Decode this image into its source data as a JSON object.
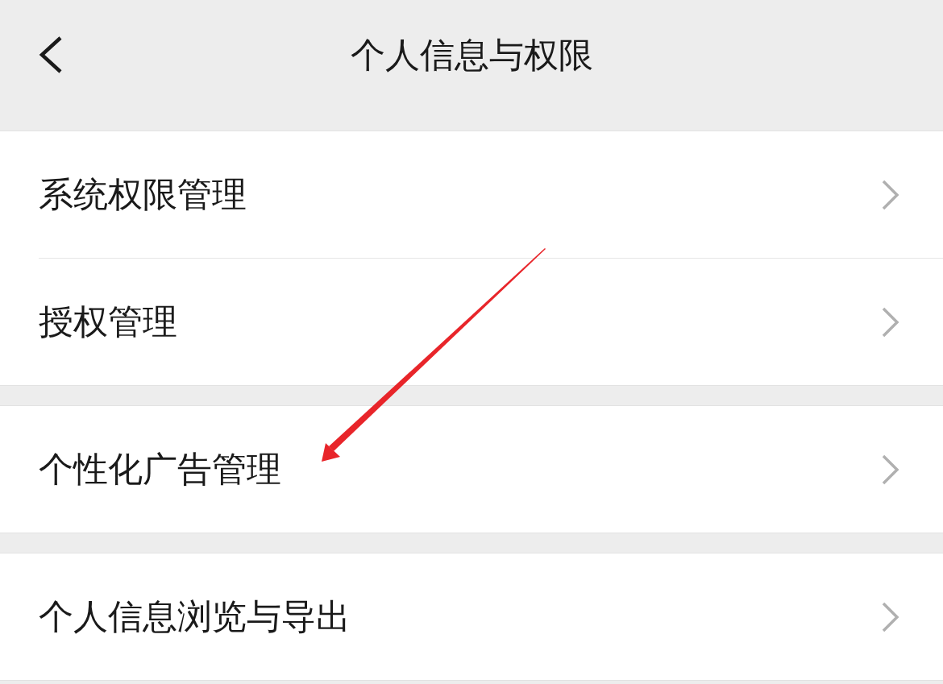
{
  "header": {
    "title": "个人信息与权限"
  },
  "groups": [
    {
      "items": [
        {
          "label": "系统权限管理"
        },
        {
          "label": "授权管理"
        }
      ]
    },
    {
      "items": [
        {
          "label": "个性化广告管理"
        }
      ]
    },
    {
      "items": [
        {
          "label": "个人信息浏览与导出"
        }
      ]
    }
  ]
}
